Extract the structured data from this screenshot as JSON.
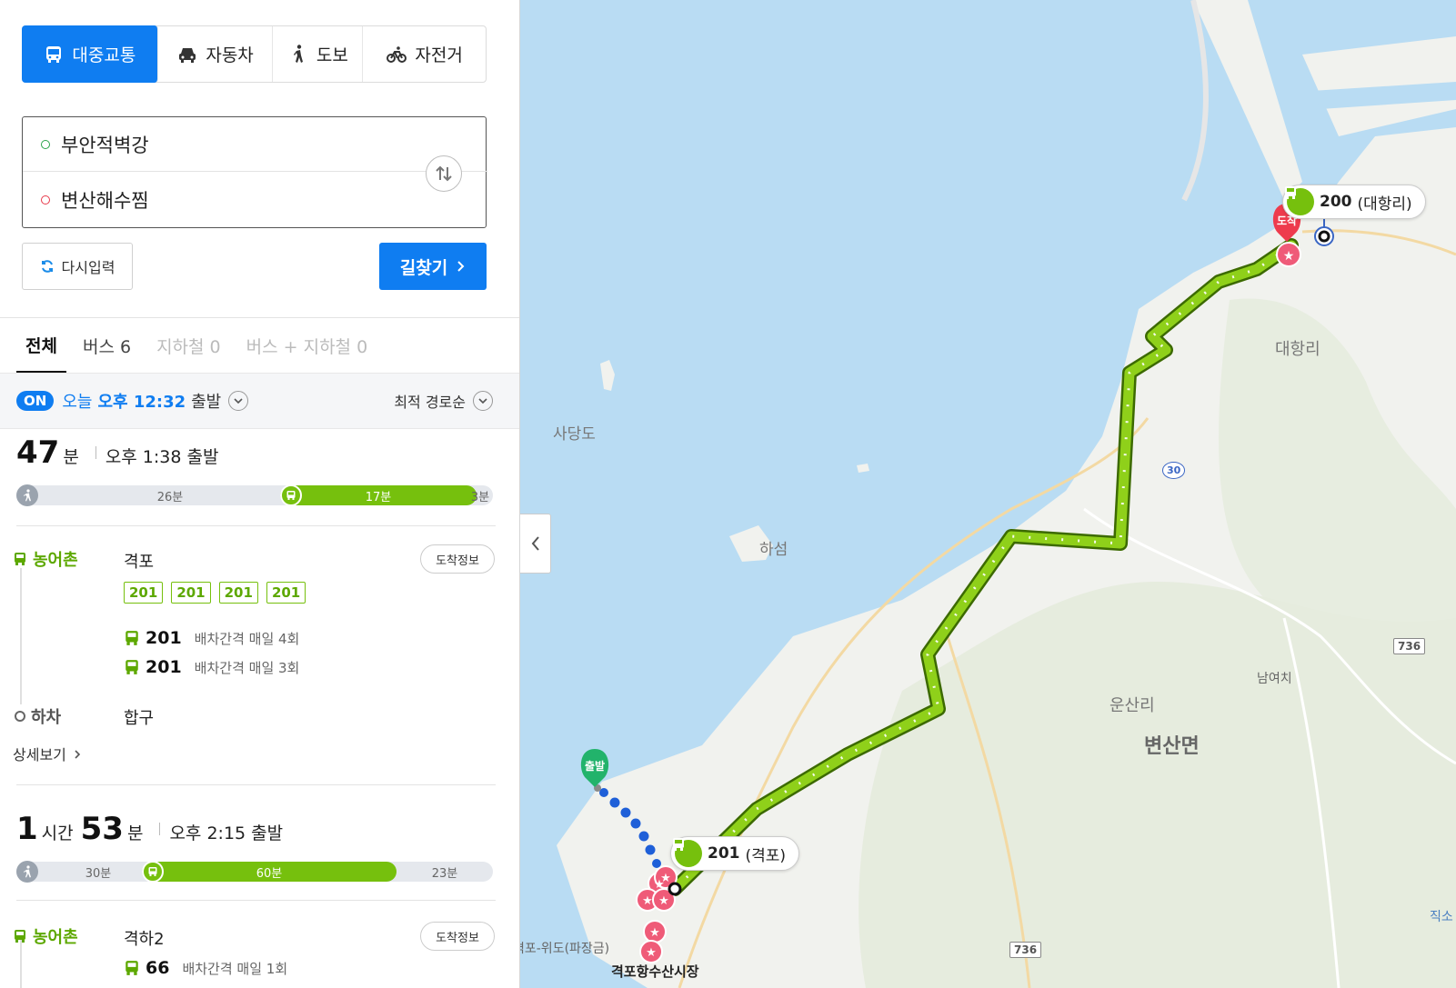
{
  "modes": {
    "transit": "대중교통",
    "car": "자동차",
    "walk": "도보",
    "bike": "자전거"
  },
  "route": {
    "origin": "부안적벽강",
    "destination": "변산해수찜"
  },
  "actions": {
    "reset": "다시입력",
    "find": "길찾기"
  },
  "result_tabs": [
    "전체",
    "버스 6",
    "지하철 0",
    "버스 + 지하철 0"
  ],
  "departure": {
    "on_badge": "ON",
    "today": "오늘",
    "time": "오후 12:32",
    "label": "출발",
    "sort": "최적 경로순"
  },
  "routes": [
    {
      "duration_main": "47",
      "duration_unit": "분",
      "depart_text": "오후 1:38 출발",
      "segments": {
        "walk": "26분",
        "bus": "17분",
        "end_walk": "3분"
      },
      "board_type": "농어촌",
      "board_stop": "격포",
      "arrive_info": "도착정보",
      "badges": [
        "201",
        "201",
        "201",
        "201"
      ],
      "lines": [
        {
          "num": "201",
          "info": "배차간격 매일 4회"
        },
        {
          "num": "201",
          "info": "배차간격 매일 3회"
        }
      ],
      "alight_label": "하차",
      "alight_stop": "합구",
      "detail": "상세보기"
    },
    {
      "duration_hours": "1",
      "hours_unit": "시간",
      "duration_main": "53",
      "duration_unit": "분",
      "depart_text": "오후 2:15 출발",
      "segments": {
        "walk": "30분",
        "bus": "60분",
        "end_walk": "23분"
      },
      "board_type": "농어촌",
      "board_stop": "격하2",
      "arrive_info": "도착정보",
      "lines": [
        {
          "num": "66",
          "info": "배차간격 매일 1회"
        }
      ]
    }
  ],
  "map": {
    "labels": {
      "sadangdo": "사당도",
      "haseom": "하섬",
      "daehangri": "대항리",
      "unsanri": "운산리",
      "byeonsanmyeon": "변산면",
      "namyeochi": "남여치",
      "gyeokpo_market": "격포항수산시장",
      "ferry": "격포-위도(파장금)",
      "jikso": "직소"
    },
    "roads": {
      "r30": "30",
      "r736a": "736",
      "r736b": "736"
    },
    "bus_tags": {
      "top": {
        "num": "200",
        "stop": "(대항리)"
      },
      "bottom": {
        "num": "201",
        "stop": "(격포)"
      }
    },
    "pins": {
      "start": "출발",
      "end": "도착"
    },
    "colors": {
      "sea": "#b9dcf3",
      "land": "#f2f3f0",
      "route": "#76c00d",
      "walk": "#1e5fd8",
      "accent": "#0f7df1"
    }
  }
}
